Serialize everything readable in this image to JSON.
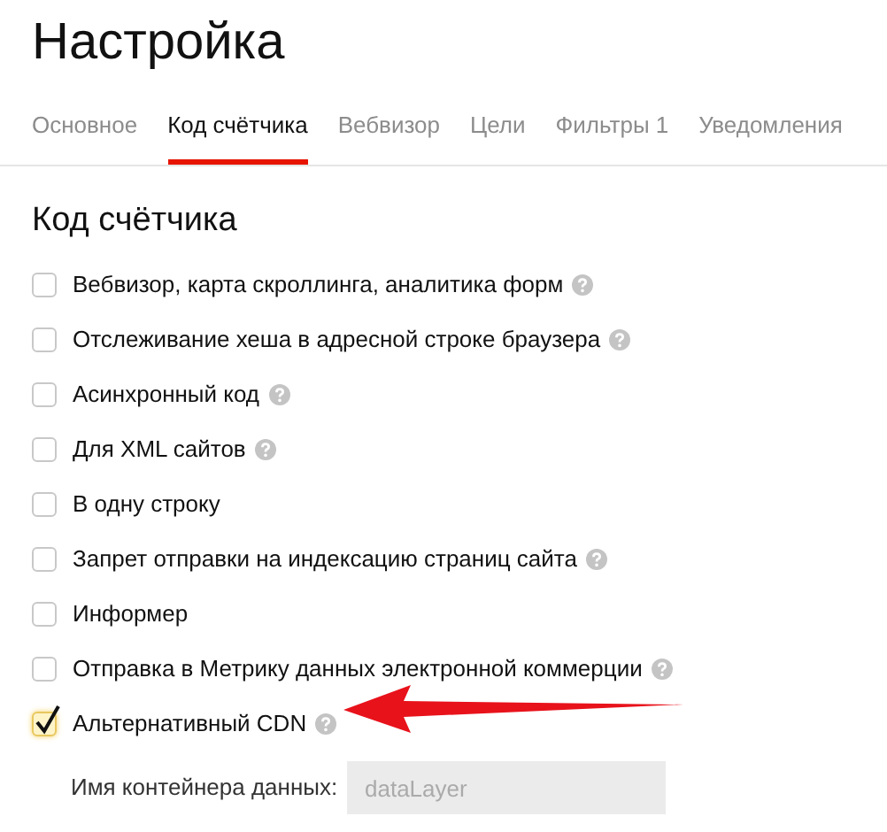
{
  "title": "Настройка",
  "tabs": [
    {
      "label": "Основное",
      "selected": false
    },
    {
      "label": "Код счётчика",
      "selected": true
    },
    {
      "label": "Вебвизор",
      "selected": false
    },
    {
      "label": "Цели",
      "selected": false
    },
    {
      "label": "Фильтры 1",
      "selected": false
    },
    {
      "label": "Уведомления",
      "selected": false
    }
  ],
  "section_title": "Код счётчика",
  "options": [
    {
      "label": "Вебвизор, карта скроллинга, аналитика форм",
      "checked": false,
      "help": true
    },
    {
      "label": "Отслеживание хеша в адресной строке браузера",
      "checked": false,
      "help": true
    },
    {
      "label": "Асинхронный код",
      "checked": false,
      "help": true
    },
    {
      "label": "Для XML сайтов",
      "checked": false,
      "help": true
    },
    {
      "label": "В одну строку",
      "checked": false,
      "help": false
    },
    {
      "label": "Запрет отправки на индексацию страниц сайта",
      "checked": false,
      "help": true
    },
    {
      "label": "Информер",
      "checked": false,
      "help": false
    },
    {
      "label": "Отправка в Метрику данных электронной коммерции",
      "checked": false,
      "help": true
    },
    {
      "label": "Альтернативный CDN",
      "checked": true,
      "help": true
    }
  ],
  "container_field": {
    "label": "Имя контейнера данных:",
    "placeholder": "dataLayer",
    "disabled": true
  }
}
